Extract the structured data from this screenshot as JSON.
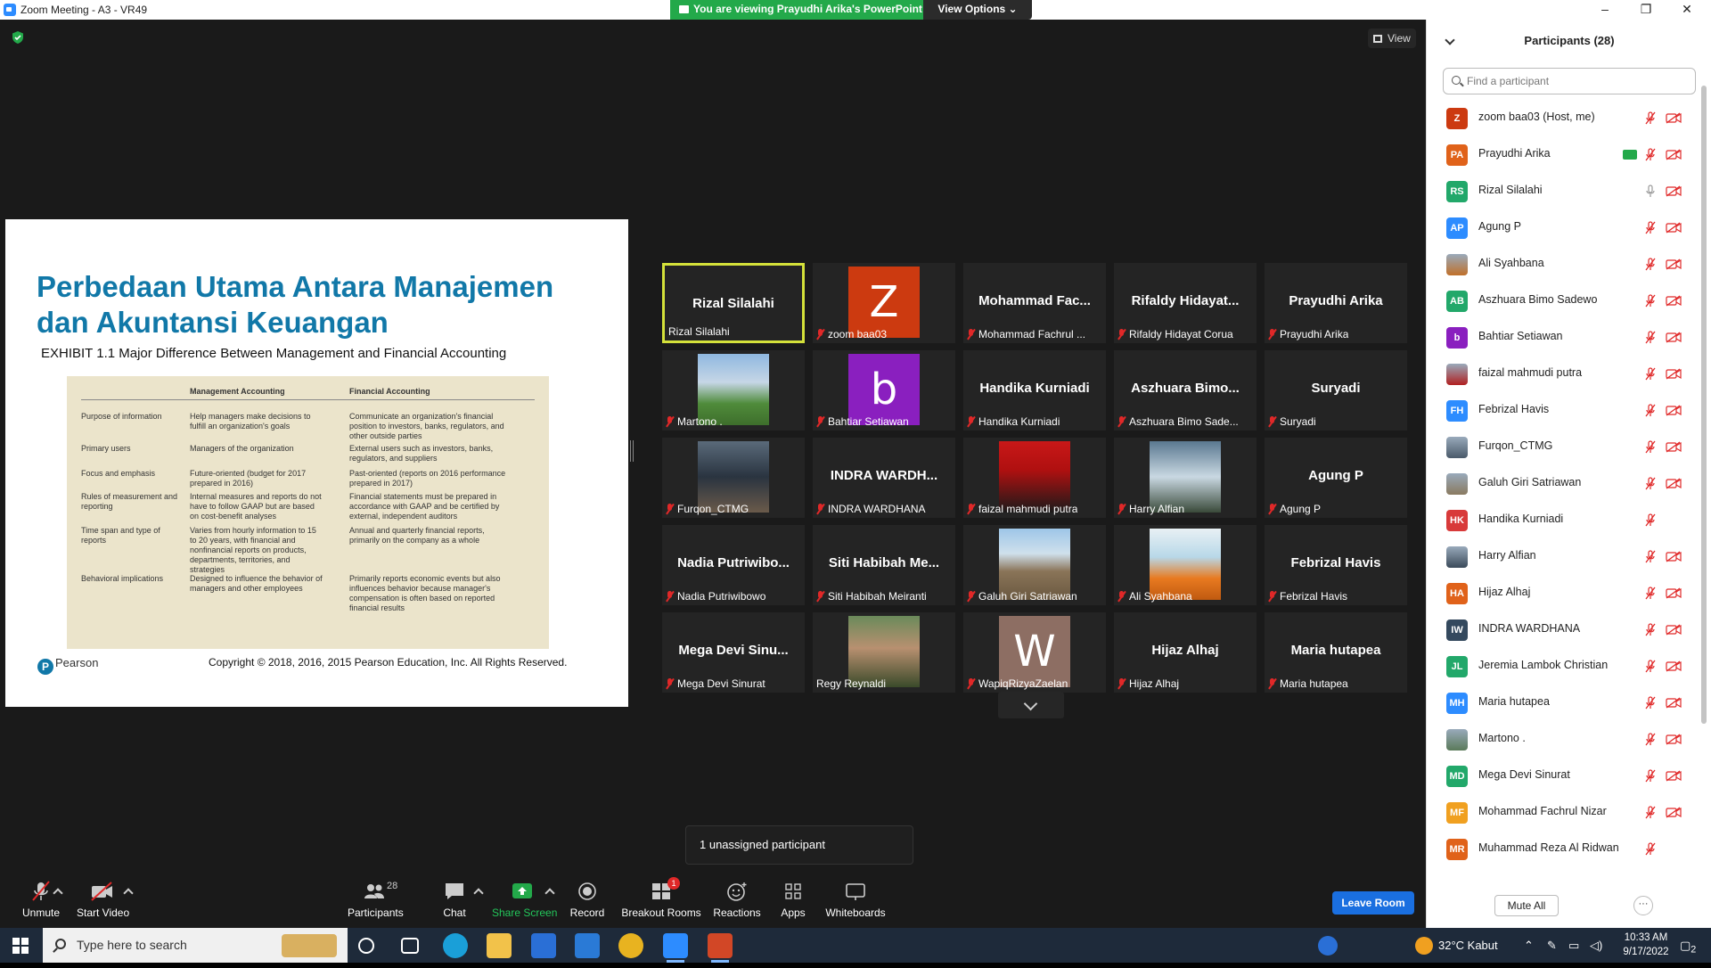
{
  "window": {
    "title": "Zoom Meeting - A3 - VR49",
    "share_banner": "You are viewing Prayudhi Arika's PowerPoint",
    "view_options": "View Options",
    "view_label": "View"
  },
  "slide": {
    "title": "Perbedaan Utama Antara Manajemen dan Akuntansi Keuangan",
    "subtitle": "EXHIBIT 1.1 Major Difference Between Management and Financial Accounting",
    "col_mgmt": "Management Accounting",
    "col_fin": "Financial Accounting",
    "rows": [
      {
        "label": "Purpose of information",
        "mgmt": "Help managers make decisions to fulfill an organization's goals",
        "fin": "Communicate an organization's financial position to investors, banks, regulators, and other outside parties"
      },
      {
        "label": "Primary users",
        "mgmt": "Managers of the organization",
        "fin": "External users such as investors, banks, regulators, and suppliers"
      },
      {
        "label": "Focus and emphasis",
        "mgmt": "Future-oriented (budget for 2017 prepared in 2016)",
        "fin": "Past-oriented (reports on 2016 performance prepared in 2017)"
      },
      {
        "label": "Rules of measurement and reporting",
        "mgmt": "Internal measures and reports do not have to follow GAAP but are based on cost-benefit analyses",
        "fin": "Financial statements must be prepared in accordance with GAAP and be certified by external, independent auditors"
      },
      {
        "label": "Time span and type of reports",
        "mgmt": "Varies from hourly information to 15 to 20 years, with financial and nonfinancial reports on products, departments, territories, and strategies",
        "fin": "Annual and quarterly financial reports, primarily on the company as a whole"
      },
      {
        "label": "Behavioral implications",
        "mgmt": "Designed to influence the behavior of managers and other employees",
        "fin": "Primarily reports economic events but also influences behavior because manager's compensation is often based on reported financial results"
      }
    ],
    "publisher": "Pearson",
    "copyright": "Copyright © 2018, 2016, 2015 Pearson Education, Inc. All Rights Reserved."
  },
  "gallery": [
    {
      "big": "Rizal Silalahi",
      "label": "Rizal Silalahi",
      "muted": false,
      "active": true
    },
    {
      "big": "",
      "label": "zoom baa03",
      "muted": true,
      "letter": "Z",
      "color": "#cc3a10"
    },
    {
      "big": "Mohammad Fac...",
      "label": "Mohammad Fachrul ...",
      "muted": true
    },
    {
      "big": "Rifaldy  Hidayat...",
      "label": "Rifaldy Hidayat Corua",
      "muted": true
    },
    {
      "big": "Prayudhi Arika",
      "label": "Prayudhi Arika",
      "muted": true
    },
    {
      "big": "",
      "label": "Martono .",
      "muted": true,
      "photo": "banner"
    },
    {
      "big": "",
      "label": "Bahtiar Setiawan",
      "muted": true,
      "letter": "b",
      "color": "#8a1fbf"
    },
    {
      "big": "Handika Kurniadi",
      "label": "Handika Kurniadi",
      "muted": true
    },
    {
      "big": "Aszhuara  Bimo...",
      "label": "Aszhuara Bimo Sade...",
      "muted": true
    },
    {
      "big": "Suryadi",
      "label": "Suryadi",
      "muted": true
    },
    {
      "big": "",
      "label": "Furqon_CTMG",
      "muted": true,
      "photo": "person-street"
    },
    {
      "big": "INDRA  WARDH...",
      "label": "INDRA WARDHANA",
      "muted": true
    },
    {
      "big": "",
      "label": "faizal mahmudi putra",
      "muted": true,
      "photo": "person-red"
    },
    {
      "big": "",
      "label": "Harry Alfian",
      "muted": true,
      "photo": "waterfall"
    },
    {
      "big": "Agung P",
      "label": "Agung P",
      "muted": true
    },
    {
      "big": "Nadia  Putriwibo...",
      "label": "Nadia Putriwibowo",
      "muted": true
    },
    {
      "big": "Siti  Habibah  Me...",
      "label": "Siti Habibah Meiranti",
      "muted": true
    },
    {
      "big": "",
      "label": "Galuh Giri Satriawan",
      "muted": true,
      "photo": "mountain"
    },
    {
      "big": "",
      "label": "Ali Syahbana",
      "muted": true,
      "photo": "person-orange"
    },
    {
      "big": "Febrizal Havis",
      "label": "Febrizal Havis",
      "muted": true
    },
    {
      "big": "Mega  Devi  Sinu...",
      "label": "Mega Devi Sinurat",
      "muted": true
    },
    {
      "big": "",
      "label": "Regy Reynaldi",
      "muted": false,
      "photo": "person-smile"
    },
    {
      "big": "",
      "label": "WapiqRizyaZaelan",
      "muted": true,
      "letter": "W",
      "color": "#8d6e63"
    },
    {
      "big": "Hijaz Alhaj",
      "label": "Hijaz Alhaj",
      "muted": true
    },
    {
      "big": "Maria hutapea",
      "label": "Maria hutapea",
      "muted": true
    }
  ],
  "unassigned": "1 unassigned participant",
  "toolbar": {
    "unmute": "Unmute",
    "start_video": "Start Video",
    "participants": "Participants",
    "participants_count": "28",
    "chat": "Chat",
    "share_screen": "Share Screen",
    "record": "Record",
    "breakout_rooms": "Breakout Rooms",
    "breakout_badge": "1",
    "reactions": "Reactions",
    "apps": "Apps",
    "whiteboards": "Whiteboards",
    "leave": "Leave Room"
  },
  "panel": {
    "title": "Participants (28)",
    "search_placeholder": "Find a participant",
    "mute_all": "Mute All",
    "more": "···",
    "participants": [
      {
        "initials": "Z",
        "name": "zoom baa03 (Host, me)",
        "color": "#cc3a10",
        "cam": true
      },
      {
        "initials": "PA",
        "name": "Prayudhi Arika",
        "color": "#e0621a",
        "cam": true,
        "sharing": true
      },
      {
        "initials": "RS",
        "name": "Rizal Silalahi",
        "color": "#22a86a",
        "cam": true,
        "unmuted": true
      },
      {
        "initials": "AP",
        "name": "Agung P",
        "color": "#2d8cff",
        "cam": true
      },
      {
        "initials": "",
        "name": "Ali Syahbana",
        "color": "#c0702a",
        "cam": true,
        "photo": true
      },
      {
        "initials": "AB",
        "name": "Aszhuara Bimo Sadewo",
        "color": "#22a86a",
        "cam": true
      },
      {
        "initials": "b",
        "name": "Bahtiar Setiawan",
        "color": "#8a1fbf",
        "cam": true
      },
      {
        "initials": "",
        "name": "faizal mahmudi putra",
        "color": "#b02020",
        "cam": true,
        "photo": true
      },
      {
        "initials": "FH",
        "name": "Febrizal Havis",
        "color": "#2d8cff",
        "cam": true
      },
      {
        "initials": "",
        "name": "Furqon_CTMG",
        "color": "#4a5a6a",
        "cam": true,
        "photo": true
      },
      {
        "initials": "",
        "name": "Galuh Giri Satriawan",
        "color": "#8a7a60",
        "cam": true,
        "photo": true
      },
      {
        "initials": "HK",
        "name": "Handika Kurniadi",
        "color": "#d83a3a",
        "cam": false
      },
      {
        "initials": "",
        "name": "Harry Alfian",
        "color": "#3a4a5a",
        "cam": true,
        "photo": true
      },
      {
        "initials": "HA",
        "name": "Hijaz Alhaj",
        "color": "#e0621a",
        "cam": true
      },
      {
        "initials": "IW",
        "name": "INDRA WARDHANA",
        "color": "#34495e",
        "cam": true
      },
      {
        "initials": "JL",
        "name": "Jeremia Lambok Christian",
        "color": "#22a86a",
        "cam": true
      },
      {
        "initials": "MH",
        "name": "Maria hutapea",
        "color": "#2d8cff",
        "cam": true
      },
      {
        "initials": "",
        "name": "Martono .",
        "color": "#5a7a5a",
        "cam": true,
        "photo": true
      },
      {
        "initials": "MD",
        "name": "Mega Devi Sinurat",
        "color": "#22a86a",
        "cam": true
      },
      {
        "initials": "MF",
        "name": "Mohammad Fachrul Nizar",
        "color": "#f0a020",
        "cam": true
      },
      {
        "initials": "MR",
        "name": "Muhammad Reza Al Ridwan",
        "color": "#e0621a",
        "cam": false
      }
    ]
  },
  "taskbar": {
    "search_placeholder": "Type here to search",
    "weather": "32°C  Kabut",
    "time": "10:33 AM",
    "date": "9/17/2022",
    "notifications": "2"
  }
}
